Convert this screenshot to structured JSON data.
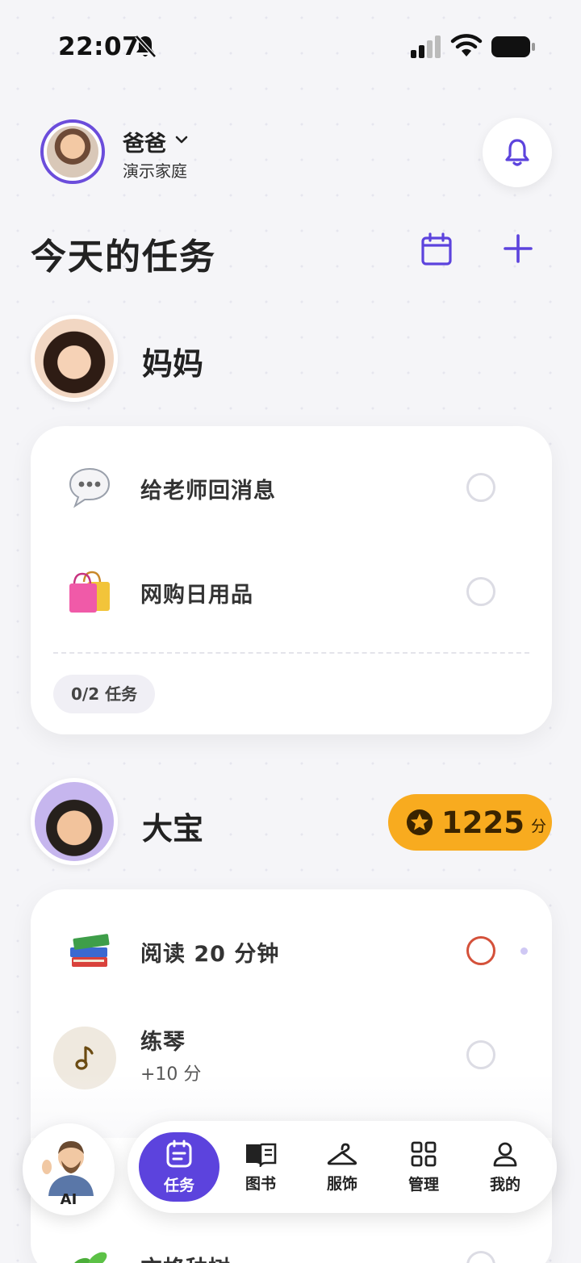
{
  "status_bar": {
    "time": "22:07",
    "icons": [
      "bell-off-icon",
      "signal-icon",
      "wifi-icon",
      "battery-icon"
    ]
  },
  "header": {
    "user_name": "爸爸",
    "family_name": "演示家庭",
    "notification_icon": "bell-icon"
  },
  "page": {
    "title": "今天的任务",
    "calendar_icon": "calendar-icon",
    "add_icon": "plus-icon"
  },
  "colors": {
    "accent": "#5c43dd",
    "points": "#f8ab1f",
    "active_check": "#d4513a",
    "background": "#f5f5f8"
  },
  "members": [
    {
      "name": "妈妈",
      "tasks": [
        {
          "title": "给老师回消息",
          "icon": "speech-bubble-icon"
        },
        {
          "title": "网购日用品",
          "icon": "shopping-bags-icon"
        }
      ],
      "progress": "0/2 任务"
    },
    {
      "name": "大宝",
      "points": {
        "value": "1225",
        "unit": "分",
        "icon": "star-icon"
      },
      "tasks": [
        {
          "title": "阅读 20 分钟",
          "icon": "books-icon"
        },
        {
          "title": "练琴",
          "subtitle": "+10 分",
          "icon": "music-note-icon"
        },
        {
          "title": "方格种树",
          "icon": "sprout-icon"
        }
      ]
    }
  ],
  "tabbar": {
    "ai_label": "AI",
    "tabs": [
      {
        "label": "任务",
        "icon": "task-list-icon",
        "active": true
      },
      {
        "label": "图书",
        "icon": "book-icon"
      },
      {
        "label": "服饰",
        "icon": "hanger-icon"
      },
      {
        "label": "管理",
        "icon": "grid-icon"
      },
      {
        "label": "我的",
        "icon": "person-icon"
      }
    ]
  }
}
